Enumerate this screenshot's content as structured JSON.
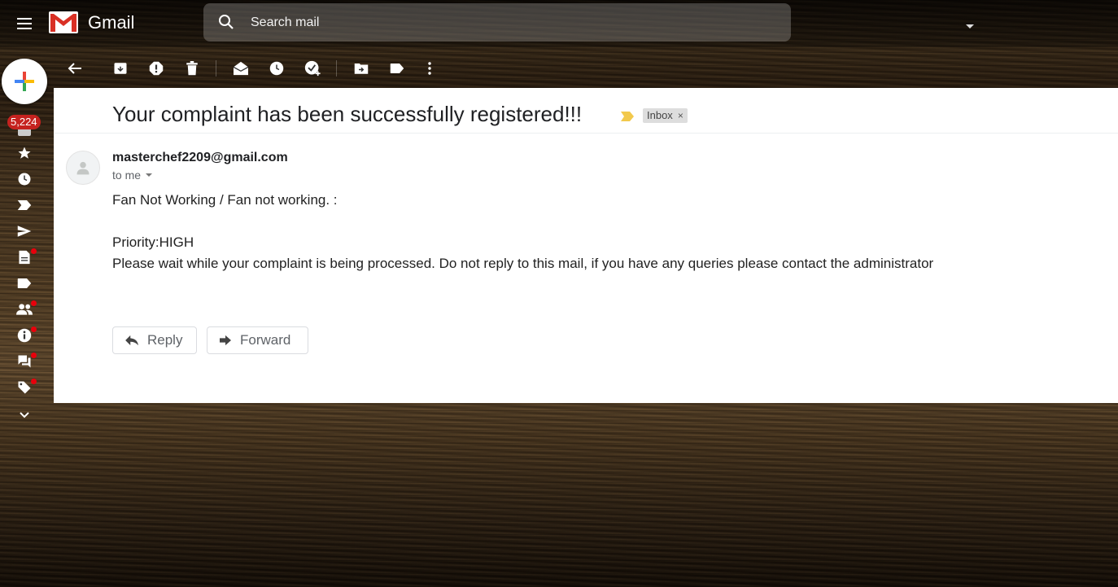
{
  "app": {
    "name": "Gmail"
  },
  "search": {
    "placeholder": "Search mail"
  },
  "sidebar": {
    "unread_count": "5,224"
  },
  "email": {
    "subject": "Your complaint has been successfully registered!!!",
    "label": "Inbox",
    "label_remove": "×",
    "sender": "masterchef2209@gmail.com",
    "recipient": "to me",
    "body": [
      "Fan Not Working / Fan not working. :",
      "Priority:HIGH",
      "Please wait while your complaint is being processed. Do not reply to this mail, if you have any queries please contact the administrator"
    ]
  },
  "actions": {
    "reply": "Reply",
    "forward": "Forward"
  },
  "colors": {
    "important_marker": "#f2c94c",
    "badge": "#c5221f"
  }
}
